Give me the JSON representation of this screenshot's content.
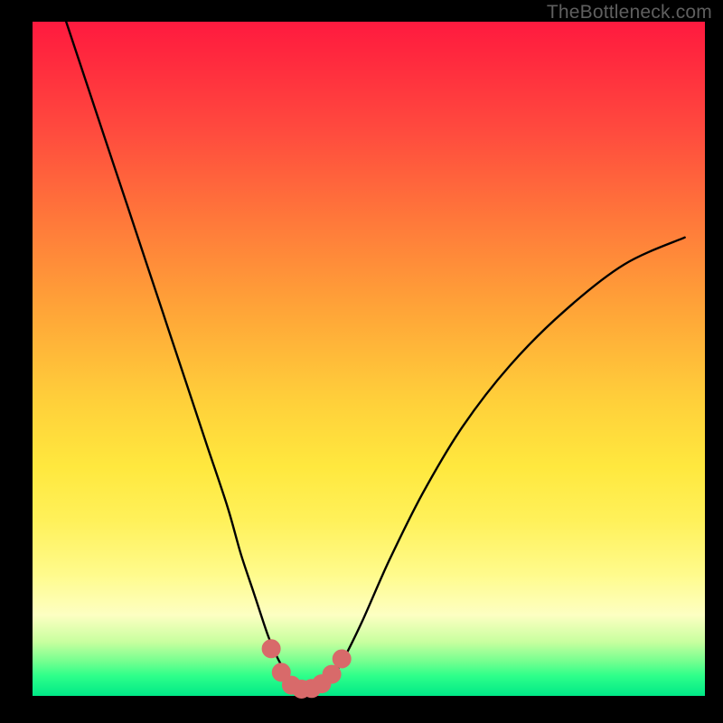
{
  "watermark": "TheBottleneck.com",
  "colors": {
    "curve_stroke": "#000000",
    "marker_fill": "#d86a6a",
    "marker_stroke": "#d86a6a"
  },
  "chart_data": {
    "type": "line",
    "title": "",
    "xlabel": "",
    "ylabel": "",
    "xlim": [
      0,
      100
    ],
    "ylim": [
      0,
      100
    ],
    "series": [
      {
        "name": "bottleneck-curve",
        "x": [
          5,
          8,
          11,
          14,
          17,
          20,
          23,
          26,
          29,
          31,
          33,
          35,
          36.5,
          38,
          39.5,
          41,
          42.5,
          44,
          46,
          49,
          53,
          58,
          64,
          71,
          79,
          88,
          97
        ],
        "y": [
          100,
          91,
          82,
          73,
          64,
          55,
          46,
          37,
          28,
          21,
          15,
          9,
          5.5,
          3,
          1.5,
          1,
          1.3,
          2.2,
          5,
          11,
          20,
          30,
          40,
          49,
          57,
          64,
          68
        ]
      }
    ],
    "markers": {
      "name": "trough-markers",
      "x": [
        35.5,
        37,
        38.5,
        40,
        41.5,
        43,
        44.5,
        46
      ],
      "y": [
        7,
        3.5,
        1.6,
        1,
        1.1,
        1.8,
        3.2,
        5.5
      ],
      "radius": 10
    }
  }
}
